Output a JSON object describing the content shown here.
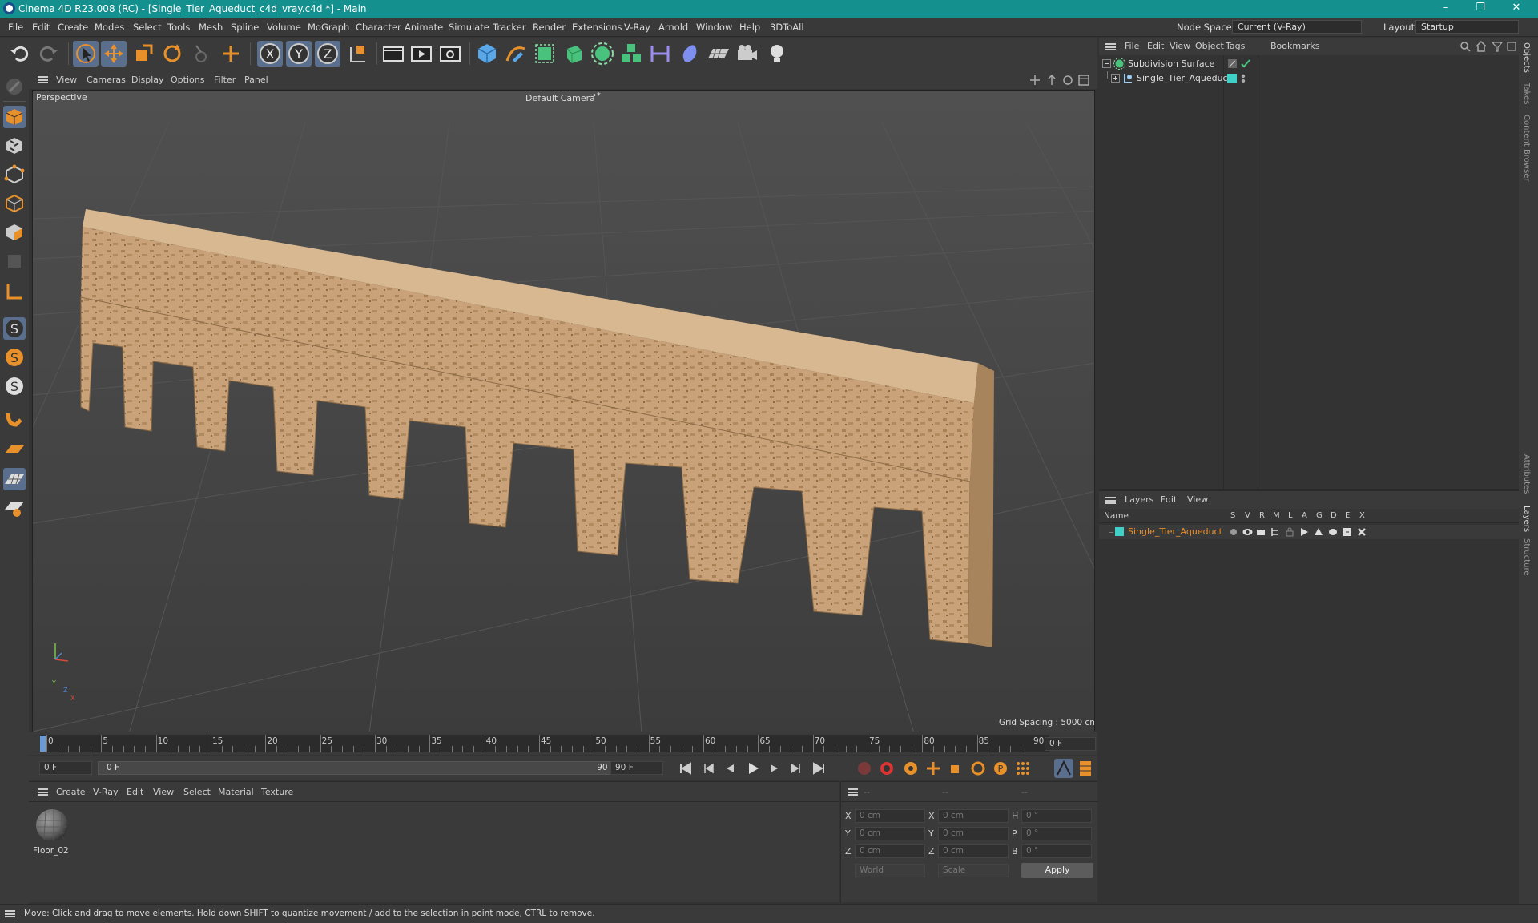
{
  "window": {
    "title": "Cinema 4D R23.008 (RC) - [Single_Tier_Aqueduct_c4d_vray.c4d *] - Main",
    "minimize": "–",
    "restore": "❐",
    "close": "✕"
  },
  "menubar": {
    "items": [
      "File",
      "Edit",
      "Create",
      "Modes",
      "Select",
      "Tools",
      "Mesh",
      "Spline",
      "Volume",
      "MoGraph",
      "Character",
      "Animate",
      "Simulate",
      "Tracker",
      "Render",
      "Extensions",
      "V-Ray",
      "Arnold",
      "Window",
      "Help",
      "3DToAll"
    ],
    "node_space_label": "Node Space:",
    "node_space_value": "Current (V-Ray)",
    "layout_label": "Layout:",
    "layout_value": "Startup"
  },
  "viewport": {
    "menu": [
      "View",
      "Cameras",
      "Display",
      "Options",
      "Filter",
      "Panel"
    ],
    "label": "Perspective",
    "camera": "Default Camera",
    "camera_icon": "•*",
    "grid_spacing": "Grid Spacing : 5000 cm",
    "axis_x": "X",
    "axis_y": "Y",
    "axis_z": "Z"
  },
  "timeline": {
    "ticks": [
      "0",
      "5",
      "10",
      "15",
      "20",
      "25",
      "30",
      "35",
      "40",
      "45",
      "50",
      "55",
      "60",
      "65",
      "70",
      "75",
      "80",
      "85",
      "90"
    ],
    "current_frame": "0 F"
  },
  "transport": {
    "start_field": "0 F",
    "range_start": "0 F",
    "range_end": "90 F",
    "end_field": "90 F"
  },
  "material_panel": {
    "menu": [
      "Create",
      "V-Ray",
      "Edit",
      "View",
      "Select",
      "Material",
      "Texture"
    ],
    "materials": [
      {
        "name": "Floor_02"
      }
    ]
  },
  "coord_panel": {
    "headers": [
      "--",
      "--",
      "--"
    ],
    "rows": [
      {
        "a": "X",
        "av": "0 cm",
        "b": "X",
        "bv": "0 cm",
        "c": "H",
        "cv": "0 °"
      },
      {
        "a": "Y",
        "av": "0 cm",
        "b": "Y",
        "bv": "0 cm",
        "c": "P",
        "cv": "0 °"
      },
      {
        "a": "Z",
        "av": "0 cm",
        "b": "Z",
        "bv": "0 cm",
        "c": "B",
        "cv": "0 °"
      }
    ],
    "space": "World",
    "mode": "Scale",
    "apply": "Apply"
  },
  "object_manager": {
    "menu": [
      "File",
      "Edit",
      "View",
      "Object",
      "Tags",
      "Bookmarks"
    ],
    "objects": [
      {
        "name": "Subdivision Surface"
      },
      {
        "name": "Single_Tier_Aqueduct"
      }
    ]
  },
  "layer_manager": {
    "menu": [
      "Layers",
      "Edit",
      "View"
    ],
    "col_name": "Name",
    "flags": [
      "S",
      "V",
      "R",
      "M",
      "L",
      "A",
      "G",
      "D",
      "E",
      "X"
    ],
    "layers": [
      {
        "name": "Single_Tier_Aqueduct",
        "color": "#3fd0c8"
      }
    ]
  },
  "side_tabs": [
    "Objects",
    "Takes",
    "Content Browser",
    "Attributes",
    "Layers",
    "Structure"
  ],
  "status": "Move: Click and drag to move elements. Hold down SHIFT to quantize movement / add to the selection in point mode, CTRL to remove.",
  "colors": {
    "accent": "#14908e",
    "orange": "#e8902a",
    "selection": "#5a6f8e",
    "layer": "#3fd0c8"
  }
}
